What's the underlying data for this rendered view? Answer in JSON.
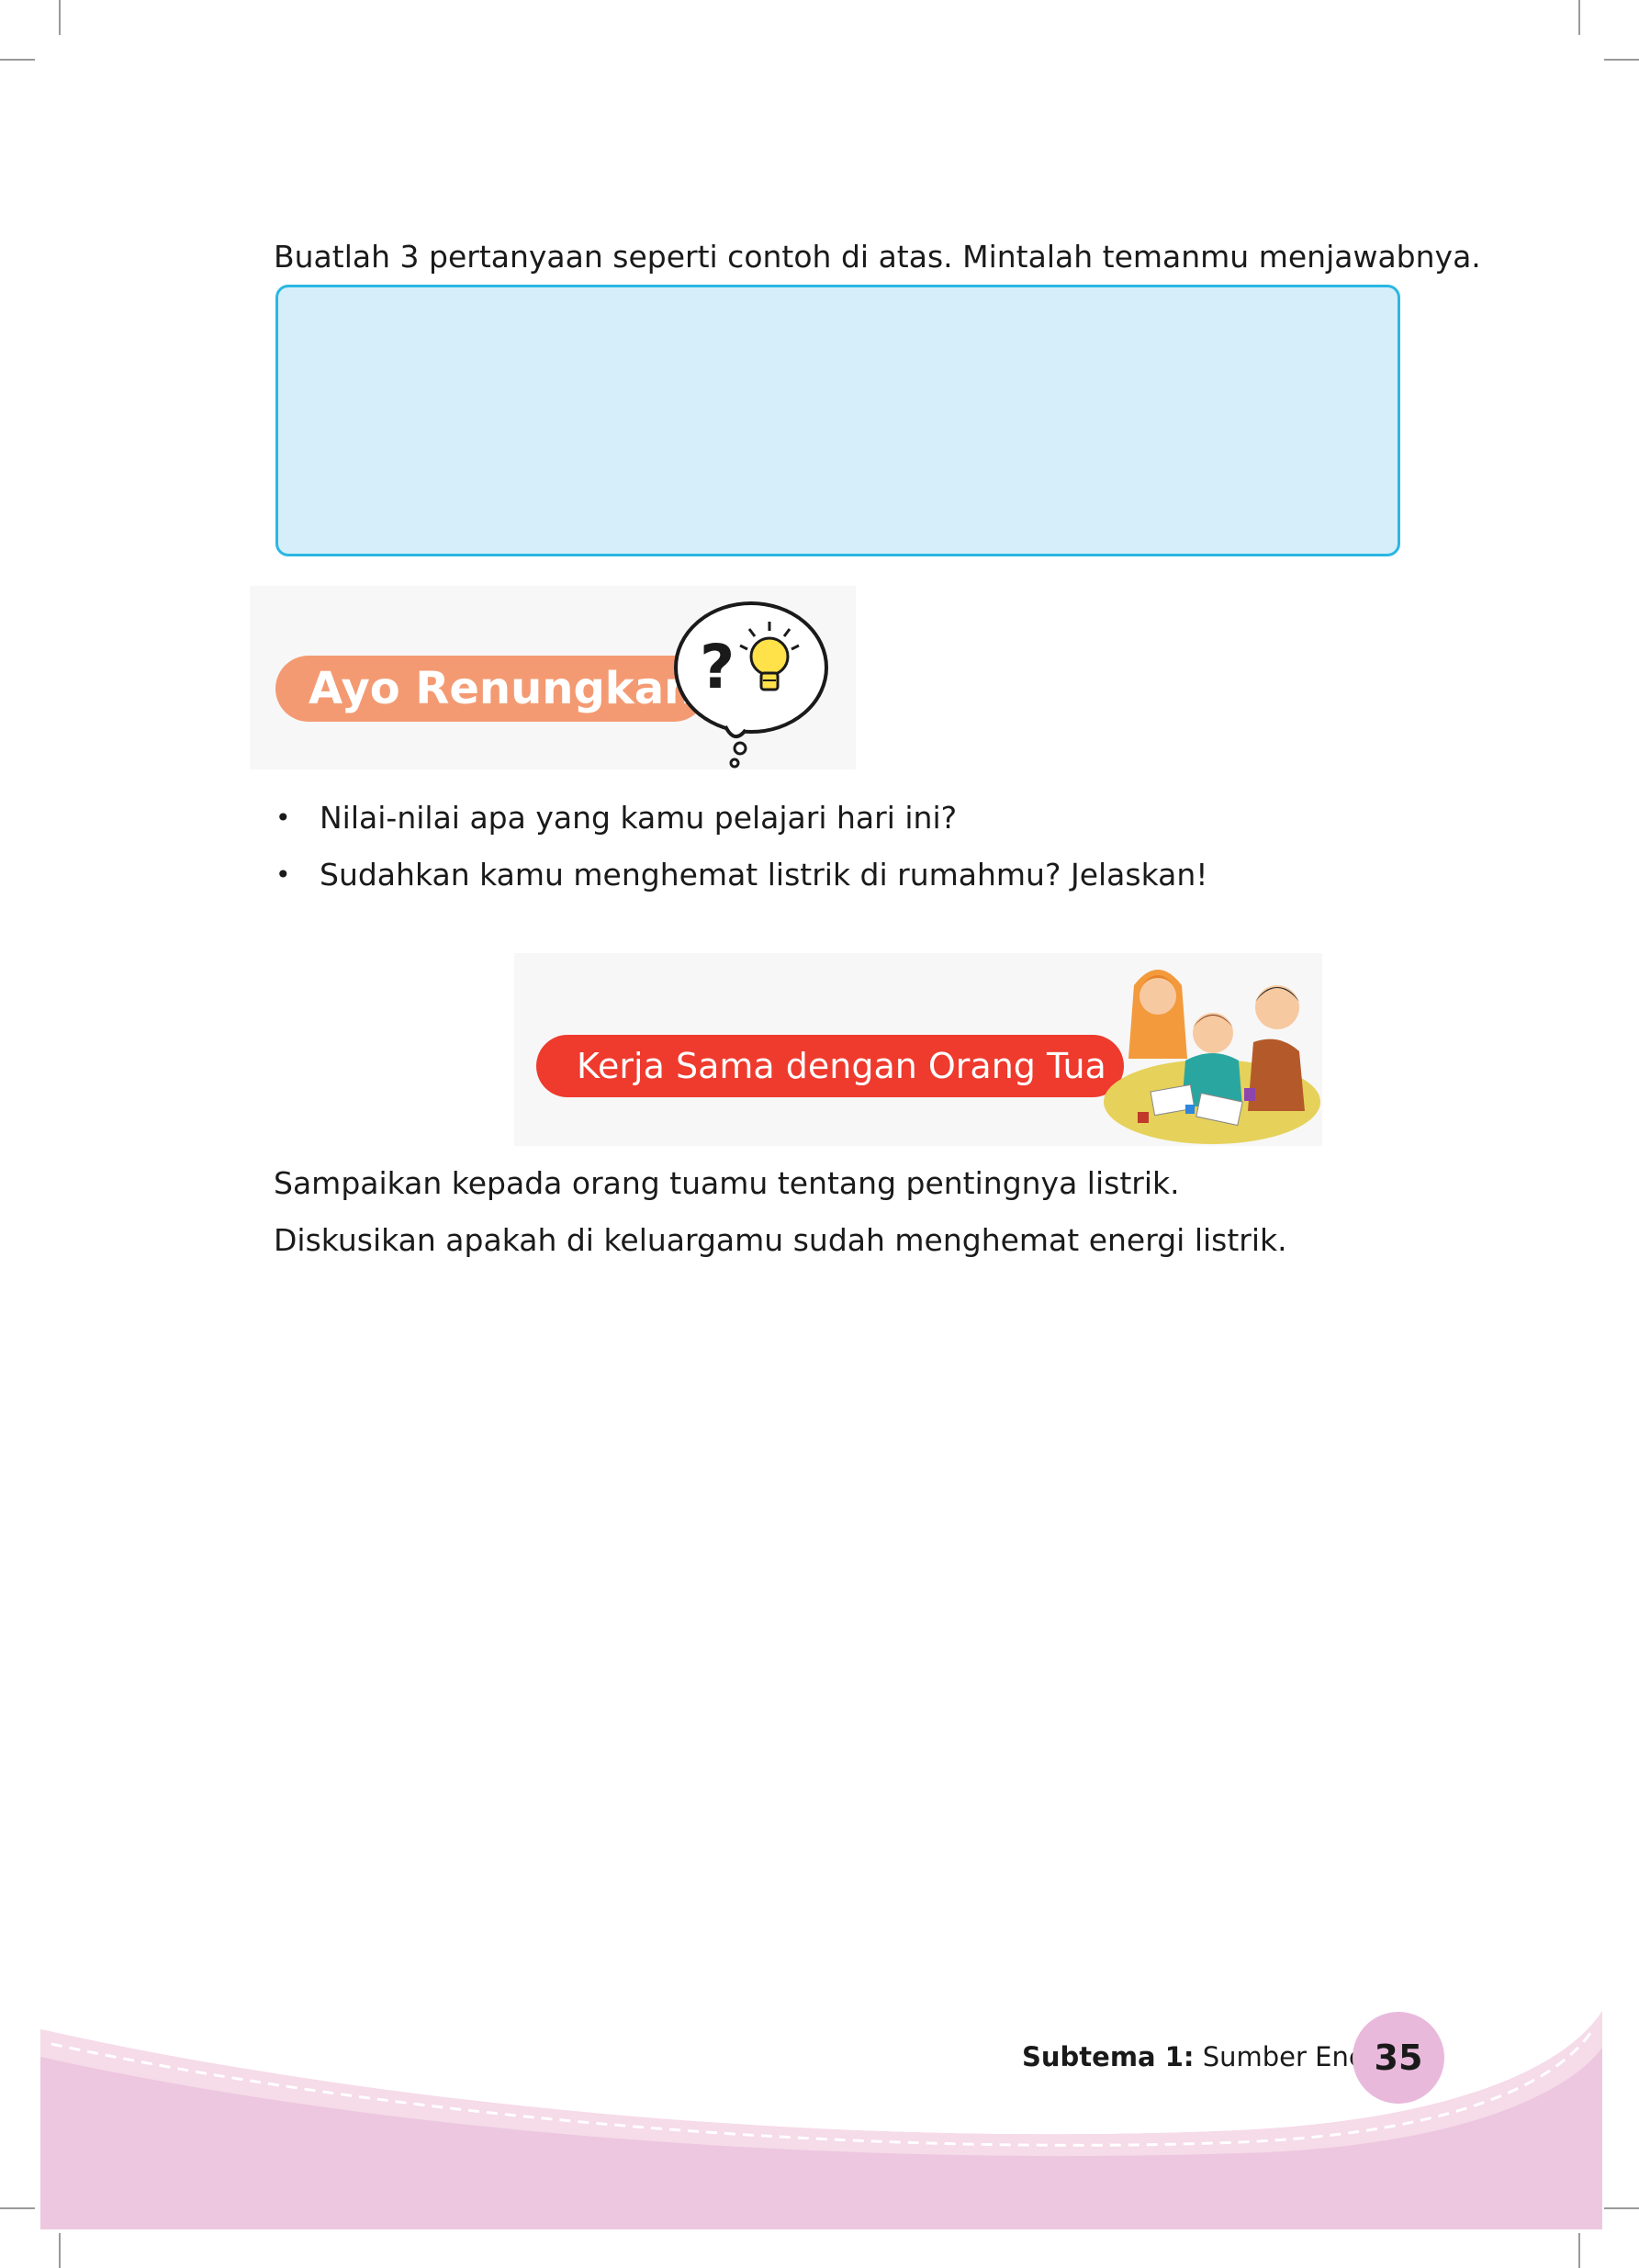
{
  "instruction": "Buatlah 3 pertanyaan seperti contoh di atas. Mintalah temanmu menjawabnya.",
  "ayo_renungkan": {
    "title": "Ayo Renungkan",
    "icon": "question-lightbulb-thought-icon",
    "questions": [
      "Nilai-nilai apa yang kamu pelajari hari ini?",
      "Sudahkan kamu menghemat listrik di rumahmu? Jelaskan!"
    ]
  },
  "kerja_sama": {
    "title": "Kerja Sama dengan Orang Tua",
    "paragraphs": [
      "Sampaikan kepada orang tuamu tentang pentingnya listrik.",
      "Diskusikan apakah di keluargamu sudah menghemat energi listrik."
    ]
  },
  "footer": {
    "subtema_label": "Subtema 1:",
    "subtema_name": " Sumber Energi",
    "page_number": "35"
  },
  "colors": {
    "answer_box_fill": "#d6eef9",
    "answer_box_border": "#2ab7e3",
    "ayo_pill": "#f49a72",
    "kerja_pill": "#ef3a2e",
    "footer_pink": "#ecc7df",
    "page_circle": "#e9b9dc"
  }
}
